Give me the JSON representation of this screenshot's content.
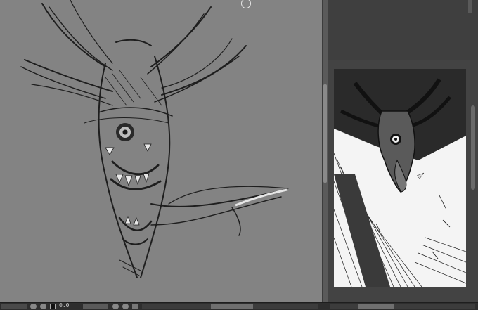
{
  "canvas": {
    "background": "#838383",
    "subject": "demon-head-sketch"
  },
  "preview_panel": {
    "background": "#434343",
    "preview_background": "#f4f4f4",
    "subject": "manga-panel-demon"
  },
  "status_bar": {
    "zoom_readout": "0.0"
  },
  "icons": {
    "zoom_out": "minus-circle-icon",
    "zoom_in": "plus-circle-icon",
    "fit": "square-icon",
    "rotate_left": "rotate-left-icon",
    "rotate_right": "rotate-right-icon",
    "flip": "flip-icon"
  }
}
